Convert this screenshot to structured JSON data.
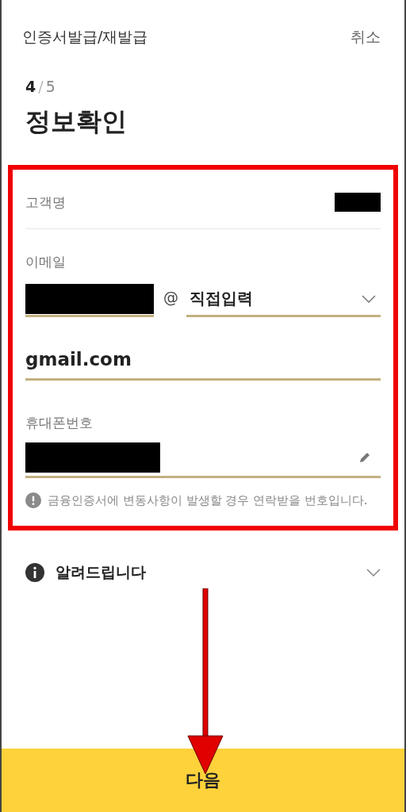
{
  "header": {
    "title": "인증서발급/재발급",
    "cancel": "취소"
  },
  "step": {
    "current": "4",
    "separator": "/",
    "total": "5"
  },
  "page_title": "정보확인",
  "customer": {
    "label": "고객명",
    "redacted": true
  },
  "email": {
    "label": "이메일",
    "redacted": true,
    "at": "@",
    "domain_select": "직접입력",
    "domain_value": "gmail.com"
  },
  "phone": {
    "label": "휴대폰번호",
    "redacted": true,
    "notice": "금융인증서에 변동사항이 발생할 경우 연락받을 번호입니다."
  },
  "notice_section": {
    "title": "알려드립니다",
    "expanded": false
  },
  "next_button": "다음"
}
